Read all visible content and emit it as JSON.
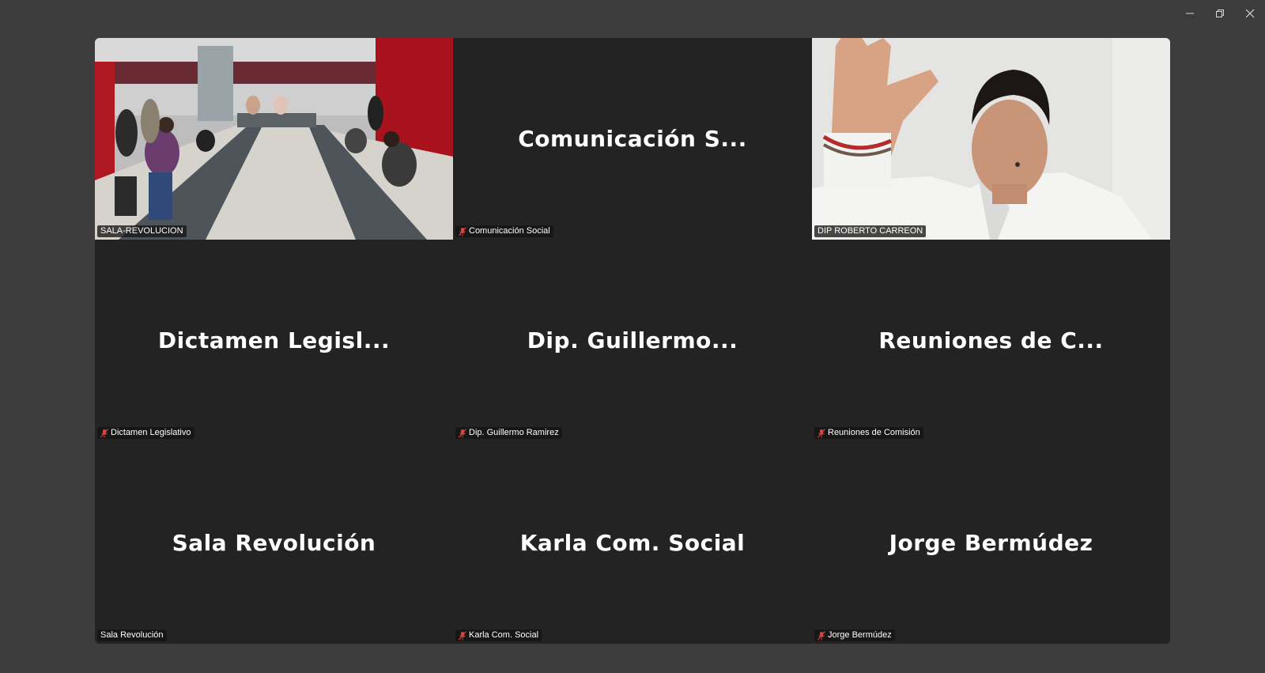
{
  "window": {
    "controls": [
      "minimize",
      "restore",
      "close"
    ]
  },
  "participants": [
    {
      "tile_title": "",
      "label": "SALA-REVOLUCION",
      "muted": false,
      "video": true,
      "speaking": false
    },
    {
      "tile_title": "Comunicación  S...",
      "label": "Comunicación Social",
      "muted": true,
      "video": false,
      "speaking": false
    },
    {
      "tile_title": "",
      "label": "DIP ROBERTO CARREON",
      "muted": false,
      "video": true,
      "speaking": true
    },
    {
      "tile_title": "Dictamen  Legisl...",
      "label": "Dictamen Legislativo",
      "muted": true,
      "video": false,
      "speaking": false
    },
    {
      "tile_title": "Dip.  Guillermo...",
      "label": "Dip. Guillermo Ramirez",
      "muted": true,
      "video": false,
      "speaking": false
    },
    {
      "tile_title": "Reuniones  de  C...",
      "label": "Reuniones de Comisión",
      "muted": true,
      "video": false,
      "speaking": false
    },
    {
      "tile_title": "Sala Revolución",
      "label": "Sala Revolución",
      "muted": false,
      "video": false,
      "speaking": false
    },
    {
      "tile_title": "Karla Com. Social",
      "label": "Karla Com. Social",
      "muted": true,
      "video": false,
      "speaking": false
    },
    {
      "tile_title": "Jorge Bermúdez",
      "label": "Jorge Bermúdez",
      "muted": true,
      "video": false,
      "speaking": false
    }
  ],
  "colors": {
    "speaking_border": "#23d96b",
    "tile_background": "#232323",
    "muted_icon": "#e0423f"
  },
  "icons": {
    "muted": "microphone-muted-icon",
    "minimize": "minimize-icon",
    "restore": "restore-icon",
    "close": "close-icon"
  }
}
